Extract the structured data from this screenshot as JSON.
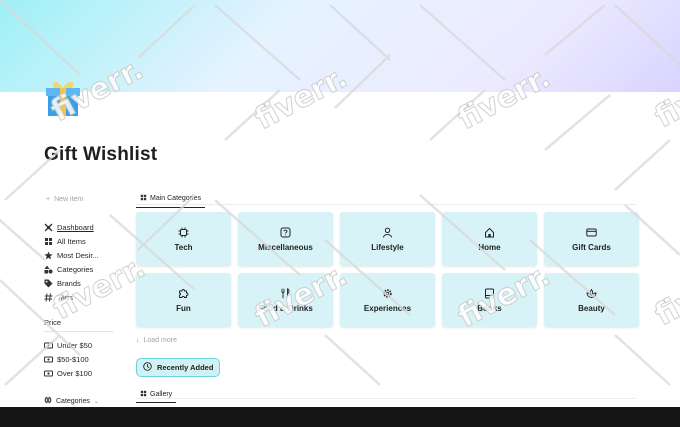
{
  "page": {
    "title": "Gift Wishlist"
  },
  "sidebar": {
    "new_item": "New item",
    "nav": [
      {
        "label": "Dashboard",
        "icon": "dashboard-icon"
      },
      {
        "label": "All Items",
        "icon": "grid-icon"
      },
      {
        "label": "Most Desir...",
        "icon": "star-icon"
      },
      {
        "label": "Categories",
        "icon": "shapes-icon"
      },
      {
        "label": "Brands",
        "icon": "tag-icon"
      },
      {
        "label": "Tags",
        "icon": "hash-icon"
      }
    ],
    "price_label": "Price",
    "price": [
      {
        "label": "Under $50",
        "icon": "cash-icon"
      },
      {
        "label": "$50-$100",
        "icon": "cash-icon"
      },
      {
        "label": "Over $100",
        "icon": "cash-icon"
      }
    ],
    "bottom_label": "Categories"
  },
  "main": {
    "tab_label": "Main Categories",
    "categories": [
      {
        "label": "Tech",
        "icon": "chip-icon"
      },
      {
        "label": "Miscellaneous",
        "icon": "question-box-icon"
      },
      {
        "label": "Lifestyle",
        "icon": "person-icon"
      },
      {
        "label": "Home",
        "icon": "home-icon"
      },
      {
        "label": "Gift Cards",
        "icon": "credit-card-icon"
      },
      {
        "label": "Fun",
        "icon": "puzzle-icon"
      },
      {
        "label": "Food & Drinks",
        "icon": "utensils-icon"
      },
      {
        "label": "Experiences",
        "icon": "settings-icon"
      },
      {
        "label": "Books",
        "icon": "book-icon"
      },
      {
        "label": "Beauty",
        "icon": "lotus-icon"
      }
    ],
    "load_more": "Load more",
    "recent_button": "Recently Added",
    "gallery_tab": "Gallery"
  },
  "watermark": "fiverr."
}
